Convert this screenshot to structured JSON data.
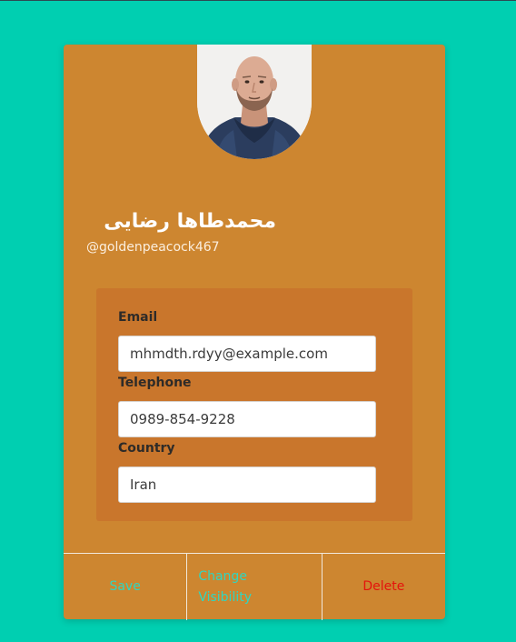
{
  "profile": {
    "name": "محمدطاها رضایی",
    "handle": "@goldenpeacock467"
  },
  "fields": {
    "email_label": "Email",
    "email_value": "mhmdth.rdyy@example.com",
    "telephone_label": "Telephone",
    "telephone_value": "0989-854-9228",
    "country_label": "Country",
    "country_value": "Iran"
  },
  "actions": {
    "save": "Save",
    "change_visibility": "Change Visibility",
    "delete": "Delete"
  },
  "colors": {
    "background": "#00cfb1",
    "card": "#cd8630",
    "panel": "#c9762c",
    "action_link": "#30d6c0",
    "delete": "#e4140c"
  }
}
